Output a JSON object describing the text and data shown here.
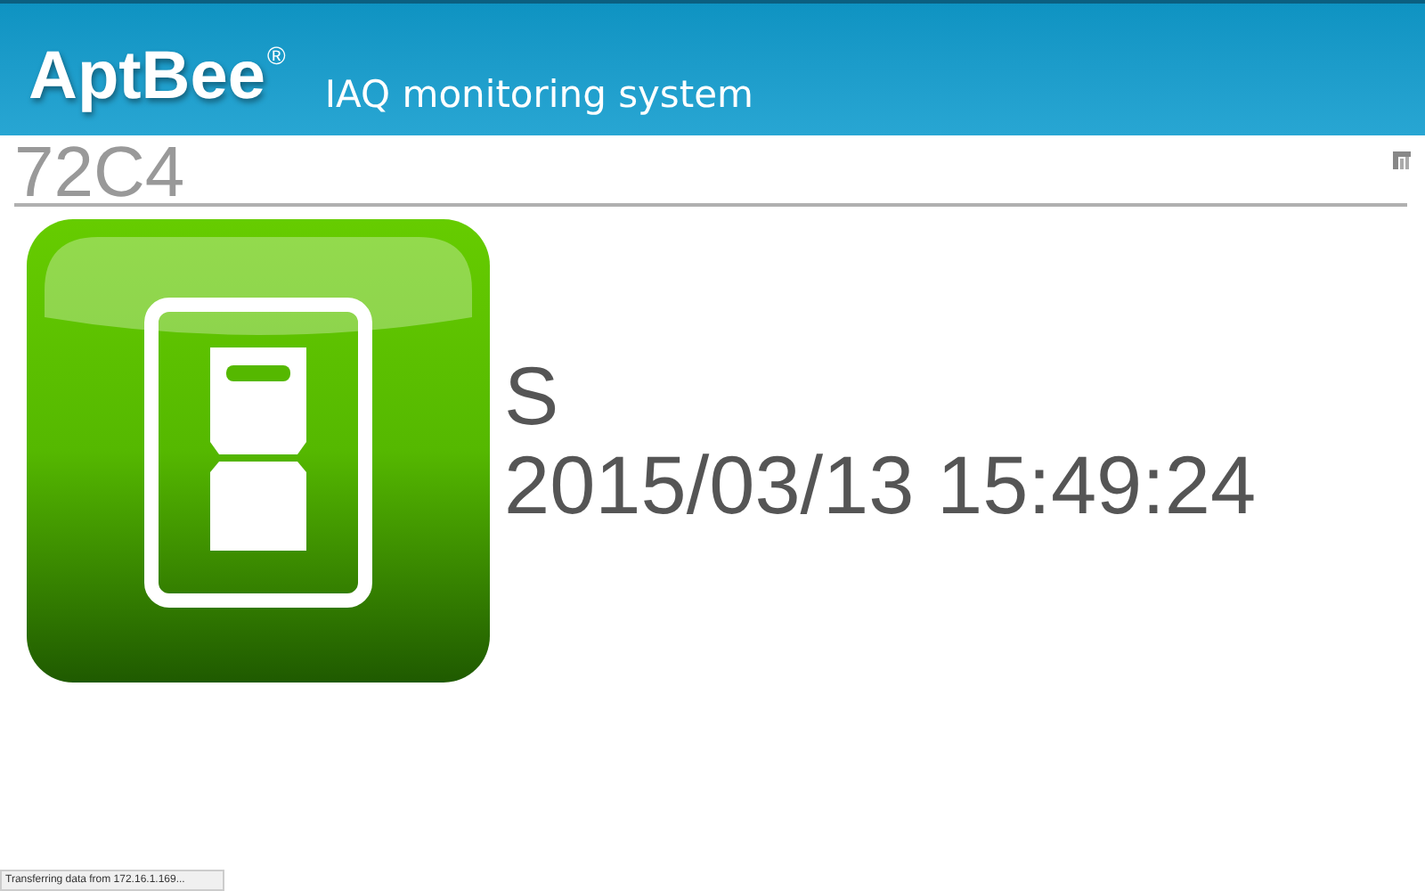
{
  "header": {
    "brand": "AptBee",
    "brand_mark": "®",
    "subtitle": "IAQ monitoring system"
  },
  "device": {
    "name": "72C4"
  },
  "status": {
    "state": "S",
    "timestamp": "2015/03/13 15:49:24"
  },
  "status_bar": {
    "text": "Transferring data from 172.16.1.169..."
  }
}
